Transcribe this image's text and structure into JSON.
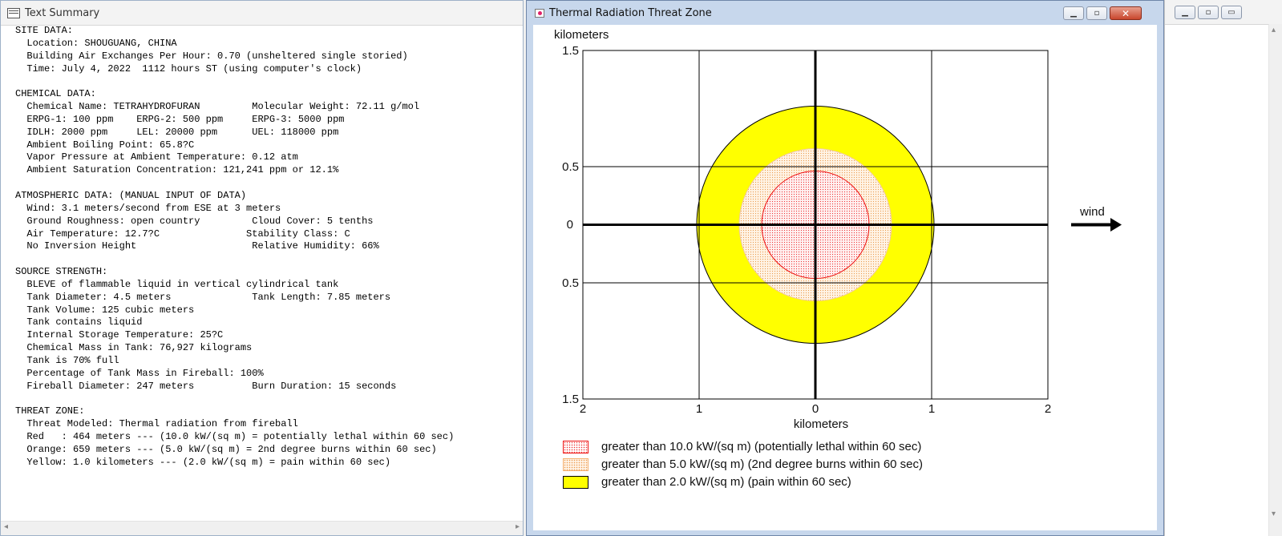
{
  "text_summary": {
    "title": "Text Summary",
    "lines": [
      "SITE DATA:",
      "  Location: SHOUGUANG, CHINA",
      "  Building Air Exchanges Per Hour: 0.70 (unsheltered single storied)",
      "  Time: July 4, 2022  1112 hours ST (using computer's clock)",
      "",
      "CHEMICAL DATA:",
      "  Chemical Name: TETRAHYDROFURAN         Molecular Weight: 72.11 g/mol",
      "  ERPG-1: 100 ppm    ERPG-2: 500 ppm     ERPG-3: 5000 ppm",
      "  IDLH: 2000 ppm     LEL: 20000 ppm      UEL: 118000 ppm",
      "  Ambient Boiling Point: 65.8?C",
      "  Vapor Pressure at Ambient Temperature: 0.12 atm",
      "  Ambient Saturation Concentration: 121,241 ppm or 12.1%",
      "",
      "ATMOSPHERIC DATA: (MANUAL INPUT OF DATA)",
      "  Wind: 3.1 meters/second from ESE at 3 meters",
      "  Ground Roughness: open country         Cloud Cover: 5 tenths",
      "  Air Temperature: 12.7?C               Stability Class: C",
      "  No Inversion Height                    Relative Humidity: 66%",
      "",
      "SOURCE STRENGTH:",
      "  BLEVE of flammable liquid in vertical cylindrical tank",
      "  Tank Diameter: 4.5 meters              Tank Length: 7.85 meters",
      "  Tank Volume: 125 cubic meters",
      "  Tank contains liquid",
      "  Internal Storage Temperature: 25?C",
      "  Chemical Mass in Tank: 76,927 kilograms",
      "  Tank is 70% full",
      "  Percentage of Tank Mass in Fireball: 100%",
      "  Fireball Diameter: 247 meters          Burn Duration: 15 seconds",
      "",
      "THREAT ZONE:",
      "  Threat Modeled: Thermal radiation from fireball",
      "  Red   : 464 meters --- (10.0 kW/(sq m) = potentially lethal within 60 sec)",
      "  Orange: 659 meters --- (5.0 kW/(sq m) = 2nd degree burns within 60 sec)",
      "  Yellow: 1.0 kilometers --- (2.0 kW/(sq m) = pain within 60 sec)"
    ]
  },
  "threat_zone": {
    "title": "Thermal Radiation Threat Zone",
    "y_unit_label": "kilometers",
    "x_unit_label": "kilometers",
    "y_tick_labels": [
      "1.5",
      "0.5",
      "0",
      "0.5",
      "1.5"
    ],
    "x_tick_labels": [
      "2",
      "1",
      "0",
      "1",
      "2"
    ],
    "wind_label": "wind",
    "legend": [
      {
        "text": "greater than 10.0 kW/(sq m) (potentially lethal within 60 sec)",
        "color": "#e02020"
      },
      {
        "text": "greater than 5.0 kW/(sq m) (2nd degree burns within 60 sec)",
        "color": "#f0a050"
      },
      {
        "text": "greater than 2.0 kW/(sq m) (pain within 60 sec)",
        "color": "#ffff00"
      }
    ],
    "zones_km": {
      "red": 0.464,
      "orange": 0.659,
      "yellow": 1.0
    },
    "axis_range_km": {
      "x": [
        -2,
        2
      ],
      "y": [
        -1.5,
        1.5
      ]
    }
  }
}
